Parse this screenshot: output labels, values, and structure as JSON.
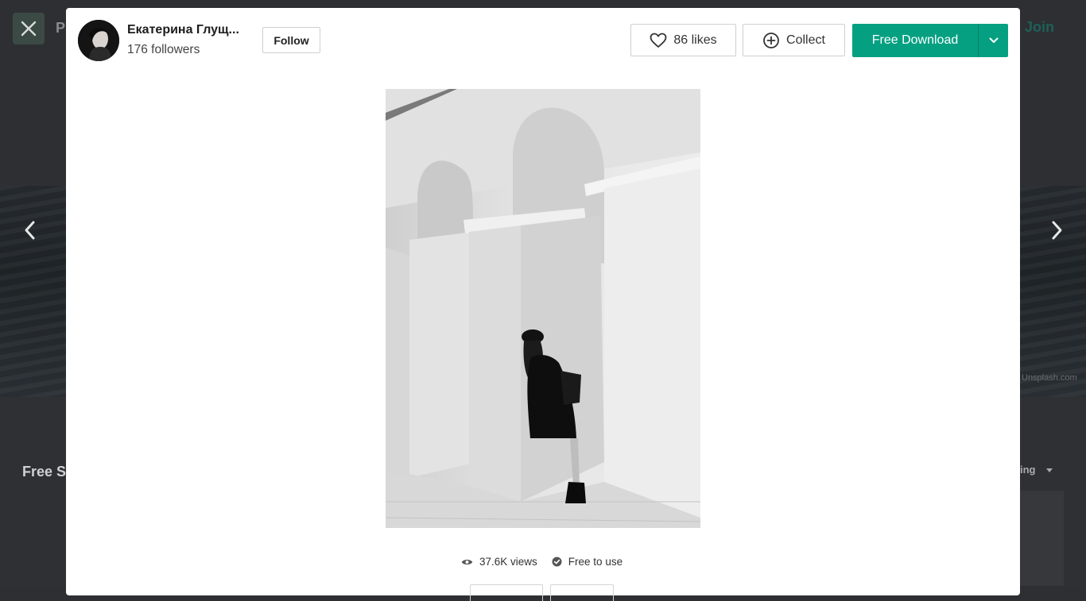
{
  "background": {
    "top_left_partial_label": "P",
    "join_label": "Join",
    "section_partial_label": "Free S",
    "sort_partial_label": "ing",
    "credit_partial": "Unsplash.com"
  },
  "author": {
    "name": "Екатерина Глущ...",
    "followers": "176 followers",
    "follow_label": "Follow"
  },
  "actions": {
    "likes_label": "86 likes",
    "collect_label": "Collect",
    "download_label": "Free Download"
  },
  "meta": {
    "views": "37.6K views",
    "license": "Free to use"
  },
  "colors": {
    "accent": "#05a081",
    "overlay": "#2e2f33"
  },
  "icons": {
    "close": "close-icon",
    "prev": "chevron-left-icon",
    "next": "chevron-right-icon",
    "heart": "heart-icon",
    "collect": "plus-circle-icon",
    "caret": "chevron-down-icon",
    "views": "eye-icon",
    "license": "check-circle-icon"
  }
}
